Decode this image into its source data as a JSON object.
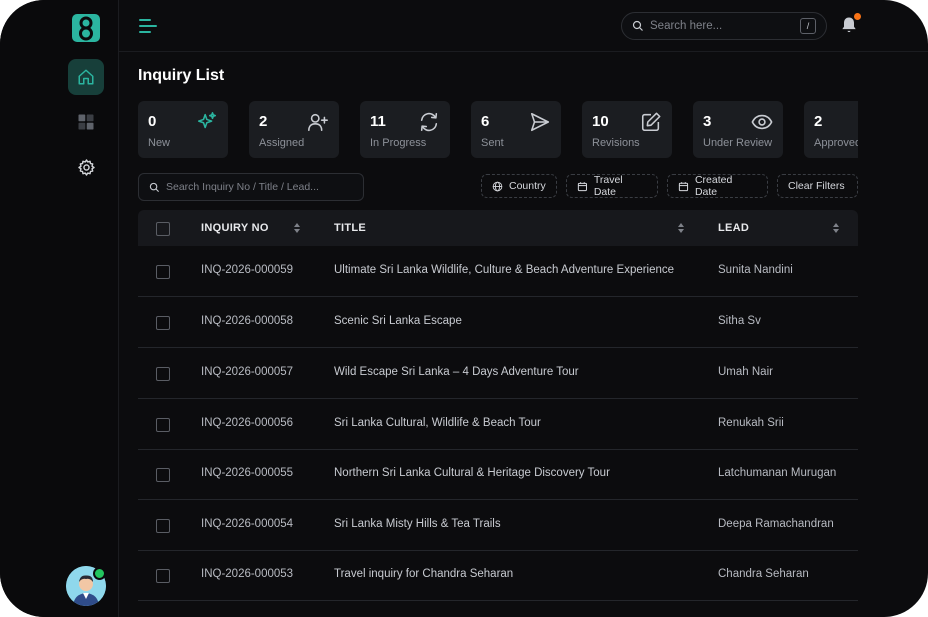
{
  "topbar": {
    "search_placeholder": "Search here...",
    "shortcut_key": "/"
  },
  "page": {
    "title": "Inquiry List"
  },
  "stats": [
    {
      "count": "0",
      "label": "New",
      "icon": "sparkles-icon"
    },
    {
      "count": "2",
      "label": "Assigned",
      "icon": "user-plus-icon"
    },
    {
      "count": "11",
      "label": "In Progress",
      "icon": "refresh-icon"
    },
    {
      "count": "6",
      "label": "Sent",
      "icon": "send-icon"
    },
    {
      "count": "10",
      "label": "Revisions",
      "icon": "edit-icon"
    },
    {
      "count": "3",
      "label": "Under Review",
      "icon": "eye-icon"
    },
    {
      "count": "2",
      "label": "Approved",
      "icon": "check-icon"
    }
  ],
  "filters": {
    "search_placeholder": "Search Inquiry No / Title / Lead...",
    "country": "Country",
    "travel_date": "Travel Date",
    "created_date": "Created Date",
    "clear": "Clear Filters"
  },
  "table": {
    "columns": {
      "inquiry_no": "INQUIRY NO",
      "title": "TITLE",
      "lead": "LEAD"
    },
    "rows": [
      {
        "inquiry_no": "INQ-2026-000059",
        "title": "Ultimate Sri Lanka Wildlife, Culture & Beach Adventure Experience",
        "lead": "Sunita Nandini"
      },
      {
        "inquiry_no": "INQ-2026-000058",
        "title": "Scenic Sri Lanka Escape",
        "lead": "Sitha Sv"
      },
      {
        "inquiry_no": "INQ-2026-000057",
        "title": "Wild Escape Sri Lanka – 4 Days Adventure Tour",
        "lead": "Umah Nair"
      },
      {
        "inquiry_no": "INQ-2026-000056",
        "title": "Sri Lanka Cultural, Wildlife & Beach Tour",
        "lead": "Renukah Srii"
      },
      {
        "inquiry_no": "INQ-2026-000055",
        "title": "Northern Sri Lanka Cultural & Heritage Discovery Tour",
        "lead": "Latchumanan Murugan"
      },
      {
        "inquiry_no": "INQ-2026-000054",
        "title": "Sri Lanka Misty Hills & Tea Trails",
        "lead": "Deepa Ramachandran"
      },
      {
        "inquiry_no": "INQ-2026-000053",
        "title": "Travel inquiry for Chandra Seharan",
        "lead": "Chandra Seharan"
      }
    ]
  },
  "colors": {
    "accent": "#2bb5a0",
    "background": "#0c0c0e",
    "card": "#1b1d21",
    "notification": "#f97316"
  }
}
